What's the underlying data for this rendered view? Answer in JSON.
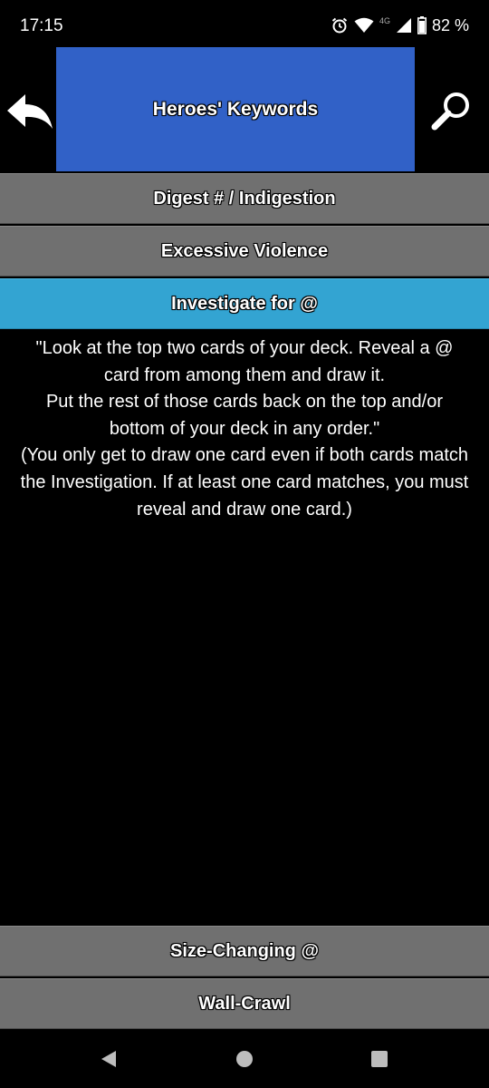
{
  "status_bar": {
    "time": "17:15",
    "network_label": "4G",
    "battery_text": "82 %",
    "icons": [
      "alarm-icon",
      "wifi-icon",
      "cell-signal-icon",
      "battery-icon"
    ]
  },
  "header": {
    "title": "Heroes' Keywords",
    "title_bg_color": "#3161c7",
    "back_icon": "back-arrow-icon",
    "search_icon": "search-icon"
  },
  "keywords": {
    "items": [
      {
        "label": "Digest # / Indigestion"
      },
      {
        "label": "Excessive Violence"
      },
      {
        "label": "Investigate for @"
      },
      {
        "label": "Size-Changing @"
      },
      {
        "label": "Wall-Crawl"
      }
    ],
    "selected_index": 2,
    "selected_color": "#33a4d2",
    "item_color": "#707070"
  },
  "detail": {
    "text": "\"Look at the top two cards of your deck. Reveal a @ card from among them and draw it.\nPut the rest of those cards back on the top and/or bottom of your deck in any order.\"\n(You only get to draw one card even if both cards match the Investigation. If at least one card matches, you must reveal and draw one card.)"
  },
  "nav_bar": {
    "icons": [
      "nav-back-icon",
      "nav-home-icon",
      "nav-recents-icon"
    ]
  }
}
